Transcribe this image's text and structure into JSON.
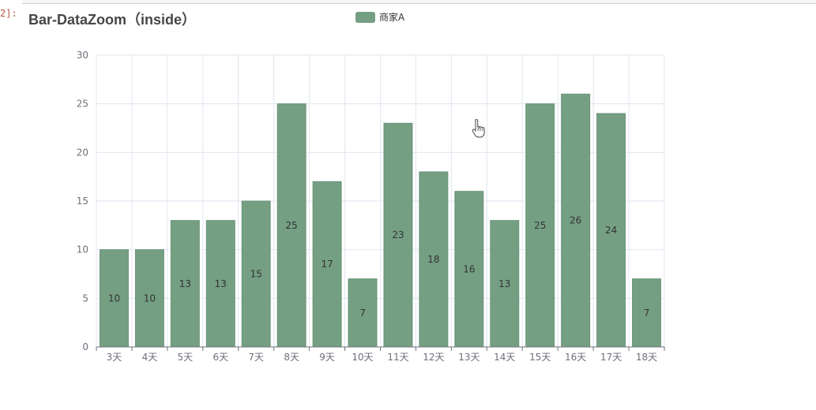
{
  "prompt": "2]:",
  "title": "Bar-DataZoom（inside）",
  "legend": {
    "label": "商家A"
  },
  "colors": {
    "bar": "#749f83",
    "bar_edge": "#6b937a",
    "axis": "#6e7079",
    "grid": "#e0e6f1",
    "label": "#333333"
  },
  "chart_data": {
    "type": "bar",
    "title": "Bar-DataZoom（inside）",
    "categories": [
      "3天",
      "4天",
      "5天",
      "6天",
      "7天",
      "8天",
      "9天",
      "10天",
      "11天",
      "12天",
      "13天",
      "14天",
      "15天",
      "16天",
      "17天",
      "18天"
    ],
    "series": [
      {
        "name": "商家A",
        "values": [
          10,
          10,
          13,
          13,
          15,
          25,
          17,
          7,
          23,
          18,
          16,
          13,
          25,
          26,
          24,
          7
        ]
      }
    ],
    "yticks": [
      0,
      5,
      10,
      15,
      20,
      25,
      30
    ],
    "ylim": [
      0,
      30
    ],
    "grid": true,
    "legend_position": "top"
  }
}
